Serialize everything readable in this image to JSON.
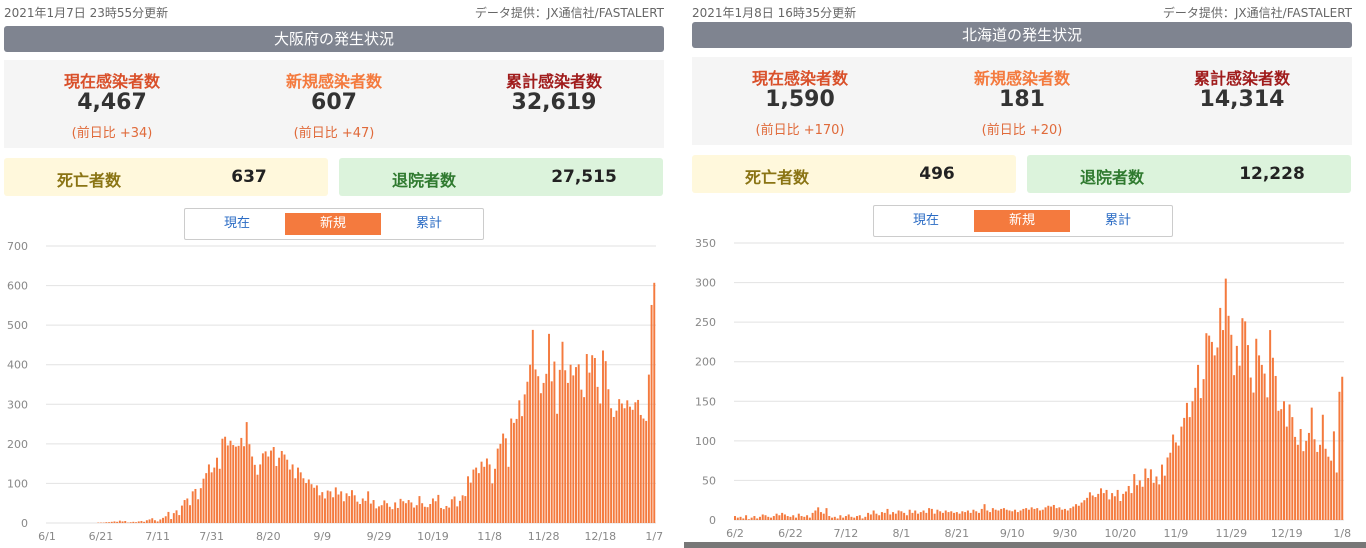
{
  "panels": [
    {
      "updated": "2021年1月7日 23時55分更新",
      "source": "データ提供：JX通信社/FASTALERT",
      "title": "大阪府の発生状況",
      "stats": [
        {
          "label": "現在感染者数",
          "value": "4,467",
          "diff": "(前日比 +34)"
        },
        {
          "label": "新規感染者数",
          "value": "607",
          "diff": "(前日比 +47)"
        },
        {
          "label": "累計感染者数",
          "value": "32,619",
          "diff": ""
        }
      ],
      "deaths": {
        "label": "死亡者数",
        "value": "637"
      },
      "recovered": {
        "label": "退院者数",
        "value": "27,515"
      },
      "tabs": [
        "現在",
        "新規",
        "累計"
      ],
      "active_tab": 1
    },
    {
      "updated": "2021年1月8日 16時35分更新",
      "source": "データ提供：JX通信社/FASTALERT",
      "title": "北海道の発生状況",
      "stats": [
        {
          "label": "現在感染者数",
          "value": "1,590",
          "diff": "(前日比 +170)"
        },
        {
          "label": "新規感染者数",
          "value": "181",
          "diff": "(前日比 +20)"
        },
        {
          "label": "累計感染者数",
          "value": "14,314",
          "diff": ""
        }
      ],
      "deaths": {
        "label": "死亡者数",
        "value": "496"
      },
      "recovered": {
        "label": "退院者数",
        "value": "12,228"
      },
      "tabs": [
        "現在",
        "新規",
        "累計"
      ],
      "active_tab": 1
    }
  ],
  "colors": {
    "bar": "#f47a3e",
    "label_current": "#d9502a",
    "label_new": "#f47a3e",
    "label_total": "#a01c1c",
    "deaths_bg": "#fff8dc",
    "deaths_label": "#8a7414",
    "recovered_bg": "#dcf3dc",
    "recovered_label": "#2f7a2f"
  },
  "chart_data": [
    {
      "type": "bar",
      "title": "",
      "xlabel": "",
      "ylabel": "",
      "ylim": [
        0,
        700
      ],
      "yticks": [
        "0",
        "100",
        "200",
        "300",
        "400",
        "500",
        "600",
        "700"
      ],
      "xtick_labels": [
        "6/1",
        "6/21",
        "7/11",
        "7/31",
        "8/20",
        "9/9",
        "9/29",
        "10/19",
        "11/8",
        "11/28",
        "12/18",
        "1/7"
      ],
      "series": [
        {
          "values": [
            0,
            0,
            0,
            0,
            0,
            0,
            0,
            0,
            0,
            0,
            0,
            0,
            0,
            0,
            0,
            0,
            0,
            0,
            0,
            1,
            1,
            1,
            2,
            2,
            3,
            4,
            3,
            6,
            4,
            5,
            1,
            2,
            3,
            2,
            4,
            5,
            3,
            7,
            9,
            12,
            7,
            4,
            9,
            13,
            17,
            28,
            10,
            25,
            32,
            20,
            44,
            58,
            62,
            45,
            80,
            86,
            60,
            88,
            112,
            126,
            148,
            128,
            140,
            165,
            137,
            213,
            218,
            196,
            208,
            197,
            193,
            195,
            215,
            194,
            255,
            199,
            168,
            147,
            122,
            148,
            176,
            181,
            168,
            183,
            192,
            144,
            165,
            182,
            173,
            160,
            135,
            148,
            113,
            140,
            128,
            113,
            101,
            110,
            98,
            89,
            95,
            70,
            78,
            62,
            82,
            80,
            65,
            90,
            72,
            80,
            55,
            75,
            68,
            83,
            70,
            54,
            48,
            62,
            56,
            80,
            49,
            58,
            37,
            42,
            45,
            57,
            50,
            41,
            35,
            52,
            38,
            61,
            55,
            50,
            58,
            52,
            39,
            45,
            68,
            50,
            41,
            40,
            48,
            62,
            55,
            71,
            38,
            35,
            43,
            39,
            60,
            67,
            42,
            56,
            70,
            68,
            118,
            102,
            135,
            140,
            126,
            155,
            142,
            163,
            148,
            100,
            137,
            188,
            200,
            226,
            214,
            142,
            264,
            253,
            263,
            310,
            270,
            325,
            357,
            400,
            488,
            388,
            371,
            328,
            354,
            377,
            478,
            358,
            408,
            276,
            387,
            458,
            386,
            354,
            400,
            373,
            394,
            401,
            337,
            318,
            427,
            380,
            424,
            417,
            344,
            302,
            436,
            409,
            338,
            290,
            268,
            284,
            313,
            302,
            290,
            310,
            294,
            286,
            305,
            311,
            273,
            264,
            258,
            375,
            551,
            607
          ]
        }
      ]
    },
    {
      "type": "bar",
      "title": "",
      "xlabel": "",
      "ylabel": "",
      "ylim": [
        0,
        350
      ],
      "yticks": [
        "0",
        "50",
        "100",
        "150",
        "200",
        "250",
        "300",
        "350"
      ],
      "xtick_labels": [
        "6/2",
        "6/22",
        "7/12",
        "8/1",
        "8/21",
        "9/10",
        "9/30",
        "10/20",
        "11/9",
        "11/29",
        "12/19",
        "1/8"
      ],
      "series": [
        {
          "values": [
            5,
            3,
            4,
            2,
            6,
            1,
            3,
            5,
            2,
            4,
            7,
            6,
            4,
            3,
            5,
            8,
            6,
            9,
            7,
            5,
            4,
            6,
            3,
            8,
            5,
            4,
            6,
            3,
            9,
            12,
            16,
            10,
            8,
            15,
            5,
            3,
            4,
            2,
            6,
            3,
            5,
            7,
            4,
            3,
            5,
            6,
            2,
            4,
            9,
            7,
            12,
            8,
            6,
            10,
            9,
            14,
            7,
            10,
            8,
            12,
            11,
            9,
            6,
            13,
            9,
            12,
            8,
            10,
            12,
            9,
            15,
            14,
            8,
            13,
            11,
            9,
            12,
            10,
            11,
            9,
            10,
            8,
            11,
            10,
            12,
            9,
            13,
            11,
            9,
            14,
            20,
            12,
            10,
            15,
            13,
            12,
            14,
            15,
            13,
            12,
            11,
            13,
            10,
            12,
            14,
            15,
            13,
            16,
            14,
            15,
            12,
            13,
            16,
            18,
            17,
            19,
            15,
            16,
            13,
            14,
            12,
            15,
            17,
            20,
            18,
            22,
            25,
            28,
            35,
            31,
            29,
            33,
            40,
            34,
            38,
            26,
            34,
            30,
            38,
            24,
            33,
            36,
            43,
            34,
            58,
            44,
            50,
            42,
            65,
            53,
            64,
            47,
            55,
            45,
            70,
            56,
            79,
            85,
            108,
            98,
            94,
            118,
            129,
            148,
            130,
            150,
            167,
            196,
            154,
            178,
            236,
            233,
            225,
            208,
            218,
            268,
            240,
            305,
            258,
            234,
            183,
            220,
            195,
            255,
            251,
            221,
            180,
            161,
            229,
            208,
            196,
            185,
            155,
            240,
            205,
            182,
            138,
            140,
            150,
            118,
            146,
            130,
            105,
            95,
            115,
            87,
            100,
            110,
            142,
            102,
            86,
            95,
            133,
            90,
            80,
            75,
            112,
            60,
            162,
            181
          ]
        }
      ]
    }
  ]
}
